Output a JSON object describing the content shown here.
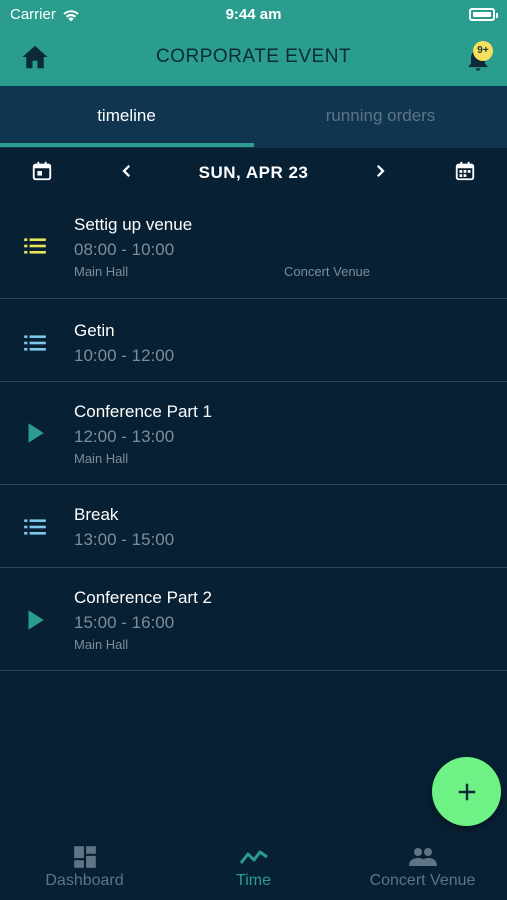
{
  "status_bar": {
    "carrier": "Carrier",
    "time": "9:44 am"
  },
  "header": {
    "title": "CORPORATE EVENT",
    "notification_count": "9+"
  },
  "tabs": [
    {
      "label": "timeline",
      "active": true
    },
    {
      "label": "running orders",
      "active": false
    }
  ],
  "date_nav": {
    "date": "SUN, APR 23"
  },
  "events": [
    {
      "title": "Settig up venue",
      "time": "08:00 - 10:00",
      "location": "Main Hall",
      "venue": "Concert Venue",
      "icon": "list-icon",
      "icon_color": "#e8e45a"
    },
    {
      "title": "Getin",
      "time": "10:00 - 12:00",
      "location": "",
      "venue": "",
      "icon": "list-icon",
      "icon_color": "#7cc9e8"
    },
    {
      "title": "Conference Part 1",
      "time": "12:00 - 13:00",
      "location": "Main Hall",
      "venue": "",
      "icon": "play-icon",
      "icon_color": "#2a9d8f"
    },
    {
      "title": "Break",
      "time": "13:00 - 15:00",
      "location": "",
      "venue": "",
      "icon": "list-icon",
      "icon_color": "#7cc9e8"
    },
    {
      "title": "Conference Part 2",
      "time": "15:00 - 16:00",
      "location": "Main Hall",
      "venue": "",
      "icon": "play-icon",
      "icon_color": "#2a9d8f"
    }
  ],
  "bottom_nav": [
    {
      "label": "Dashboard",
      "icon": "dashboard-icon",
      "active": false
    },
    {
      "label": "Time",
      "icon": "timeline-chart-icon",
      "active": true
    },
    {
      "label": "Concert Venue",
      "icon": "people-icon",
      "active": false
    }
  ],
  "colors": {
    "accent": "#2a9d8f",
    "background": "#082033",
    "tab_bar": "#0f3550",
    "fab": "#6ef286",
    "badge": "#f6e05e"
  }
}
